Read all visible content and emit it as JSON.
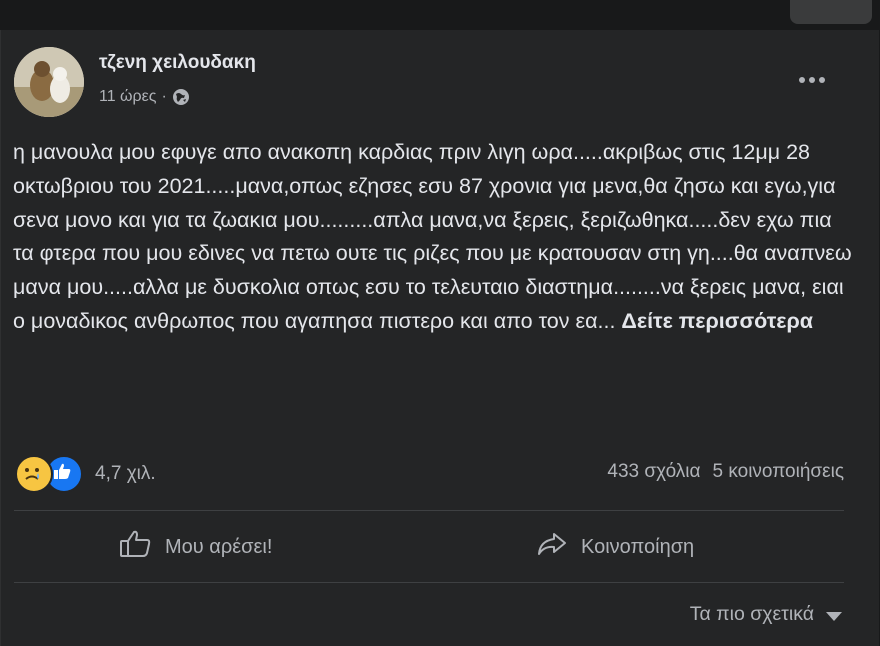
{
  "post": {
    "author": "τζενη χειλουδακη",
    "time": "11 ώρες",
    "separator": "·",
    "privacy_icon": "globe-icon",
    "more_icon": "more-dots-icon",
    "body": "η μανουλα μου εφυγε απο ανακοπη καρδιας πριν λιγη ωρα.....ακριβως στις 12μμ 28 οκτωβριου του 2021.....μανα,οπως εζησες εσυ 87 χρονια για μενα,θα ζησω και εγω,για σενα μονο και για τα ζωακια μου.........απλα μανα,να ξερεις, ξεριζωθηκα.....δεν εχω πια τα φτερα που μου εδινες να πετω ουτε τις ριζες που με κρατουσαν στη γη....θα αναπνεω μανα μου.....αλλα με δυσκολια οπως εσυ το τελευταιο διαστημα........να  ξερεις μανα, ειαι ο μοναδικος ανθρωπος που αγαπησα πιστερο και απο τον εα...",
    "see_more": "Δείτε περισσότερα"
  },
  "reactions": {
    "icons": [
      "sad-reaction-icon",
      "like-reaction-icon"
    ],
    "count": "4,7 χιλ."
  },
  "stats": {
    "comments": "433 σχόλια",
    "shares": "5 κοινοποιήσεις"
  },
  "actions": {
    "like_label": "Μου αρέσει!",
    "share_label": "Κοινοποίηση"
  },
  "comments_sort": {
    "label": "Τα πιο σχετικά"
  },
  "colors": {
    "background": "#18191a",
    "card": "#242526",
    "primary_text": "#e4e6eb",
    "secondary_text": "#b0b3b8",
    "like_blue": "#1877f2",
    "sad_yellow": "#f7c542"
  }
}
